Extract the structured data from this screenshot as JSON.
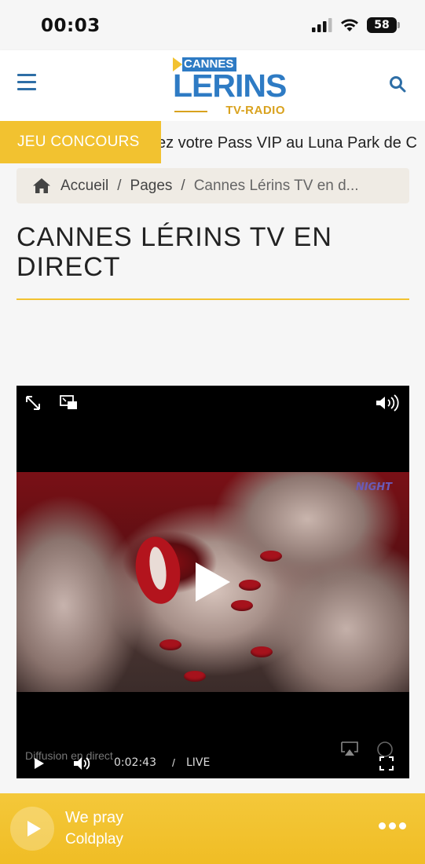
{
  "status_bar": {
    "time": "00:03",
    "battery": "58",
    "icons": [
      "signal-icon",
      "wifi-icon",
      "battery-icon"
    ]
  },
  "header": {
    "logo": {
      "cannes": "CANNES",
      "lerins": "LERINS",
      "tv_radio": "TV-RADIO"
    },
    "icons": [
      "menu-icon",
      "search-icon"
    ],
    "colors": {
      "brand_blue": "#2e7bc4",
      "brand_yellow": "#f2c230"
    }
  },
  "ticker": {
    "label": "JEU CONCOURS",
    "text": "ez votre Pass VIP au Luna Park de C"
  },
  "breadcrumb": {
    "home": "Accueil",
    "separator": "/",
    "pages": "Pages",
    "current": "Cannes Lérins TV en d..."
  },
  "page": {
    "title": "CANNES LÉRINS TV EN DIRECT"
  },
  "video": {
    "overlay_logo": "NIGHT",
    "caption": "Diffusion en direct",
    "time": "0:02:43",
    "separator": "/",
    "live": "LIVE",
    "icons": [
      "expand-icon",
      "picture-in-picture-icon",
      "volume-icon",
      "play-icon",
      "mute-icon",
      "airplay-icon",
      "fullscreen-icon"
    ]
  },
  "mini_player": {
    "track": "We pray",
    "artist": "Coldplay",
    "icons": [
      "play-icon",
      "more-icon"
    ]
  }
}
